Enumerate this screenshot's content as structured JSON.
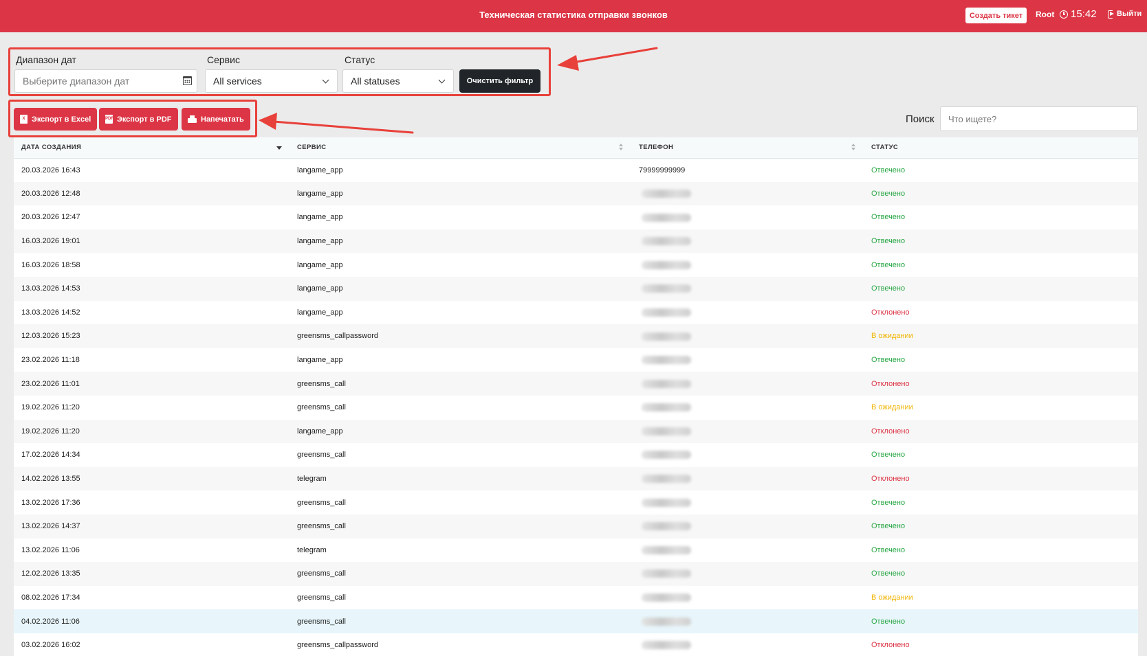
{
  "header": {
    "title": "Техническая статистика отправки звонков",
    "create_ticket": "Создать тикет",
    "user": "Root",
    "time": "15:42",
    "logout": "Выйти"
  },
  "filters": {
    "date_label": "Диапазон дат",
    "date_placeholder": "Выберите диапазон дат",
    "service_label": "Сервис",
    "service_value": "All services",
    "status_label": "Статус",
    "status_value": "All statuses",
    "clear_button": "Очистить фильтр"
  },
  "export": {
    "excel": "Экспорт в Excel",
    "pdf": "Экспорт в PDF",
    "print": "Напечатать"
  },
  "search": {
    "label": "Поиск",
    "placeholder": "Что ищете?"
  },
  "table": {
    "columns": [
      "ДАТА СОЗДАНИЯ",
      "СЕРВИС",
      "ТЕЛЕФОН",
      "СТАТУС"
    ],
    "rows": [
      {
        "date": "20.03.2026 16:43",
        "service": "langame_app",
        "phone": "79999999999",
        "status": "Отвечено",
        "kind": "ok"
      },
      {
        "date": "20.03.2026 12:48",
        "service": "langame_app",
        "phone": "",
        "status": "Отвечено",
        "kind": "ok"
      },
      {
        "date": "20.03.2026 12:47",
        "service": "langame_app",
        "phone": "",
        "status": "Отвечено",
        "kind": "ok"
      },
      {
        "date": "16.03.2026 19:01",
        "service": "langame_app",
        "phone": "",
        "status": "Отвечено",
        "kind": "ok"
      },
      {
        "date": "16.03.2026 18:58",
        "service": "langame_app",
        "phone": "",
        "status": "Отвечено",
        "kind": "ok"
      },
      {
        "date": "13.03.2026 14:53",
        "service": "langame_app",
        "phone": "",
        "status": "Отвечено",
        "kind": "ok"
      },
      {
        "date": "13.03.2026 14:52",
        "service": "langame_app",
        "phone": "",
        "status": "Отклонено",
        "kind": "rej"
      },
      {
        "date": "12.03.2026 15:23",
        "service": "greensms_callpassword",
        "phone": "",
        "status": "В ожидании",
        "kind": "wait"
      },
      {
        "date": "23.02.2026 11:18",
        "service": "langame_app",
        "phone": "",
        "status": "Отвечено",
        "kind": "ok"
      },
      {
        "date": "23.02.2026 11:01",
        "service": "greensms_call",
        "phone": "",
        "status": "Отклонено",
        "kind": "rej"
      },
      {
        "date": "19.02.2026 11:20",
        "service": "greensms_call",
        "phone": "",
        "status": "В ожидании",
        "kind": "wait"
      },
      {
        "date": "19.02.2026 11:20",
        "service": "langame_app",
        "phone": "",
        "status": "Отклонено",
        "kind": "rej"
      },
      {
        "date": "17.02.2026 14:34",
        "service": "greensms_call",
        "phone": "",
        "status": "Отвечено",
        "kind": "ok"
      },
      {
        "date": "14.02.2026 13:55",
        "service": "telegram",
        "phone": "",
        "status": "Отклонено",
        "kind": "rej"
      },
      {
        "date": "13.02.2026 17:36",
        "service": "greensms_call",
        "phone": "",
        "status": "Отвечено",
        "kind": "ok"
      },
      {
        "date": "13.02.2026 14:37",
        "service": "greensms_call",
        "phone": "",
        "status": "Отвечено",
        "kind": "ok"
      },
      {
        "date": "13.02.2026 11:06",
        "service": "telegram",
        "phone": "",
        "status": "Отвечено",
        "kind": "ok"
      },
      {
        "date": "12.02.2026 13:35",
        "service": "greensms_call",
        "phone": "",
        "status": "Отвечено",
        "kind": "ok"
      },
      {
        "date": "08.02.2026 17:34",
        "service": "greensms_call",
        "phone": "",
        "status": "В ожидании",
        "kind": "wait"
      },
      {
        "date": "04.02.2026 11:06",
        "service": "greensms_call",
        "phone": "",
        "status": "Отвечено",
        "kind": "ok"
      },
      {
        "date": "03.02.2026 16:02",
        "service": "greensms_callpassword",
        "phone": "",
        "status": "Отклонено",
        "kind": "rej"
      },
      {
        "date": "",
        "service": "",
        "phone": "",
        "status": "",
        "kind": "ok"
      }
    ],
    "highlighted_row": 19
  },
  "colors": {
    "brand": "#dc3545",
    "answered": "#28a745",
    "rejected": "#dc3545",
    "pending": "#f0b400",
    "annotation": "#e8403a"
  }
}
